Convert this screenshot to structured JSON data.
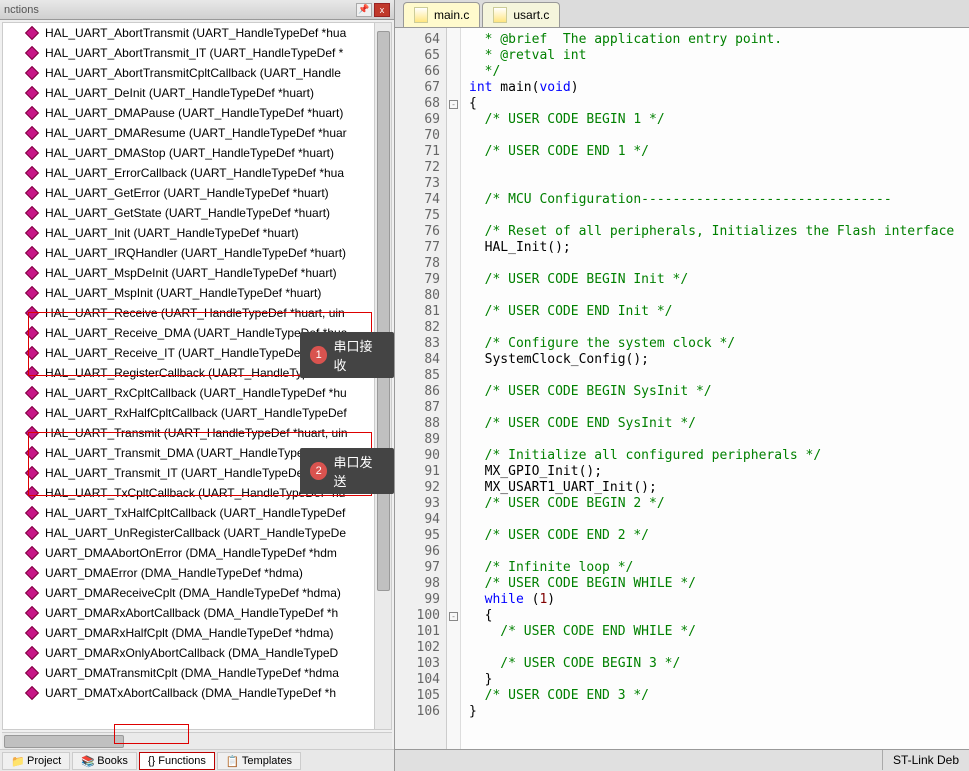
{
  "panel": {
    "title": "nctions",
    "close": "x"
  },
  "functions": [
    "HAL_UART_AbortTransmit (UART_HandleTypeDef *hua",
    "HAL_UART_AbortTransmit_IT (UART_HandleTypeDef *",
    "HAL_UART_AbortTransmitCpltCallback (UART_Handle",
    "HAL_UART_DeInit (UART_HandleTypeDef *huart)",
    "HAL_UART_DMAPause (UART_HandleTypeDef *huart)",
    "HAL_UART_DMAResume (UART_HandleTypeDef *huar",
    "HAL_UART_DMAStop (UART_HandleTypeDef *huart)",
    "HAL_UART_ErrorCallback (UART_HandleTypeDef *hua",
    "HAL_UART_GetError (UART_HandleTypeDef *huart)",
    "HAL_UART_GetState (UART_HandleTypeDef *huart)",
    "HAL_UART_Init (UART_HandleTypeDef *huart)",
    "HAL_UART_IRQHandler (UART_HandleTypeDef *huart)",
    "HAL_UART_MspDeInit (UART_HandleTypeDef *huart)",
    "HAL_UART_MspInit (UART_HandleTypeDef *huart)",
    "HAL_UART_Receive (UART_HandleTypeDef *huart, uin",
    "HAL_UART_Receive_DMA (UART_HandleTypeDef *hua",
    "HAL_UART_Receive_IT (UART_HandleTypeDef *huart, u",
    "HAL_UART_RegisterCallback (UART_HandleTypeDef *hua",
    "HAL_UART_RxCpltCallback (UART_HandleTypeDef *hu",
    "HAL_UART_RxHalfCpltCallback (UART_HandleTypeDef",
    "HAL_UART_Transmit (UART_HandleTypeDef *huart, uin",
    "HAL_UART_Transmit_DMA (UART_HandleTypeDef *hua",
    "HAL_UART_Transmit_IT (UART_HandleTypeDef *huart,",
    "HAL_UART_TxCpltCallback (UART_HandleTypeDef *hu",
    "HAL_UART_TxHalfCpltCallback (UART_HandleTypeDef",
    "HAL_UART_UnRegisterCallback (UART_HandleTypeDe",
    "UART_DMAAbortOnError (DMA_HandleTypeDef *hdm",
    "UART_DMAError (DMA_HandleTypeDef *hdma)",
    "UART_DMAReceiveCplt (DMA_HandleTypeDef *hdma)",
    "UART_DMARxAbortCallback (DMA_HandleTypeDef *h",
    "UART_DMARxHalfCplt (DMA_HandleTypeDef *hdma)",
    "UART_DMARxOnlyAbortCallback (DMA_HandleTypeD",
    "UART_DMATransmitCplt (DMA_HandleTypeDef *hdma",
    "UART_DMATxAbortCallback (DMA_HandleTypeDef *h"
  ],
  "bottom_tabs": {
    "project": "Project",
    "books": "Books",
    "functions": "{} Functions",
    "templates": "Templates"
  },
  "editor_tabs": {
    "main": "main.c",
    "usart": "usart.c"
  },
  "code_lines": [
    {
      "n": 64,
      "cls": "c-comment",
      "t": "  * @brief  The application entry point."
    },
    {
      "n": 65,
      "cls": "c-comment",
      "t": "  * @retval int"
    },
    {
      "n": 66,
      "cls": "c-comment",
      "t": "  */"
    },
    {
      "n": 67,
      "cls": "",
      "t": "<span class='c-keyword'>int</span> main(<span class='c-keyword'>void</span>)"
    },
    {
      "n": 68,
      "cls": "",
      "t": "{",
      "fold": "-"
    },
    {
      "n": 69,
      "cls": "c-comment",
      "t": "  /* USER CODE BEGIN 1 */"
    },
    {
      "n": 70,
      "cls": "",
      "t": ""
    },
    {
      "n": 71,
      "cls": "c-comment",
      "t": "  /* USER CODE END 1 */"
    },
    {
      "n": 72,
      "cls": "",
      "t": ""
    },
    {
      "n": 73,
      "cls": "",
      "t": ""
    },
    {
      "n": 74,
      "cls": "c-comment",
      "t": "  /* MCU Configuration--------------------------------"
    },
    {
      "n": 75,
      "cls": "",
      "t": ""
    },
    {
      "n": 76,
      "cls": "c-comment",
      "t": "  /* Reset of all peripherals, Initializes the Flash interface"
    },
    {
      "n": 77,
      "cls": "",
      "t": "  HAL_Init();"
    },
    {
      "n": 78,
      "cls": "",
      "t": ""
    },
    {
      "n": 79,
      "cls": "c-comment",
      "t": "  /* USER CODE BEGIN Init */"
    },
    {
      "n": 80,
      "cls": "",
      "t": ""
    },
    {
      "n": 81,
      "cls": "c-comment",
      "t": "  /* USER CODE END Init */"
    },
    {
      "n": 82,
      "cls": "",
      "t": ""
    },
    {
      "n": 83,
      "cls": "c-comment",
      "t": "  /* Configure the system clock */"
    },
    {
      "n": 84,
      "cls": "",
      "t": "  SystemClock_Config();"
    },
    {
      "n": 85,
      "cls": "",
      "t": ""
    },
    {
      "n": 86,
      "cls": "c-comment",
      "t": "  /* USER CODE BEGIN SysInit */"
    },
    {
      "n": 87,
      "cls": "",
      "t": ""
    },
    {
      "n": 88,
      "cls": "c-comment",
      "t": "  /* USER CODE END SysInit */"
    },
    {
      "n": 89,
      "cls": "",
      "t": ""
    },
    {
      "n": 90,
      "cls": "c-comment",
      "t": "  /* Initialize all configured peripherals */"
    },
    {
      "n": 91,
      "cls": "",
      "t": "  MX_GPIO_Init();"
    },
    {
      "n": 92,
      "cls": "",
      "t": "  MX_USART1_UART_Init();"
    },
    {
      "n": 93,
      "cls": "c-comment",
      "t": "  /* USER CODE BEGIN 2 */"
    },
    {
      "n": 94,
      "cls": "",
      "t": ""
    },
    {
      "n": 95,
      "cls": "c-comment",
      "t": "  /* USER CODE END 2 */"
    },
    {
      "n": 96,
      "cls": "",
      "t": ""
    },
    {
      "n": 97,
      "cls": "c-comment",
      "t": "  /* Infinite loop */"
    },
    {
      "n": 98,
      "cls": "c-comment",
      "t": "  /* USER CODE BEGIN WHILE */"
    },
    {
      "n": 99,
      "cls": "",
      "t": "  <span class='c-keyword'>while</span> (<span class='c-num'>1</span>)"
    },
    {
      "n": 100,
      "cls": "",
      "t": "  {",
      "fold": "-"
    },
    {
      "n": 101,
      "cls": "c-comment",
      "t": "    /* USER CODE END WHILE */"
    },
    {
      "n": 102,
      "cls": "",
      "t": ""
    },
    {
      "n": 103,
      "cls": "c-comment",
      "t": "    /* USER CODE BEGIN 3 */"
    },
    {
      "n": 104,
      "cls": "",
      "t": "  }"
    },
    {
      "n": 105,
      "cls": "c-comment",
      "t": "  /* USER CODE END 3 */"
    },
    {
      "n": 106,
      "cls": "",
      "t": "}"
    }
  ],
  "annotations": {
    "a1_num": "1",
    "a1_text": "串口接收",
    "a2_num": "2",
    "a2_text": "串口发送"
  },
  "status": {
    "right": "ST-Link Deb"
  }
}
